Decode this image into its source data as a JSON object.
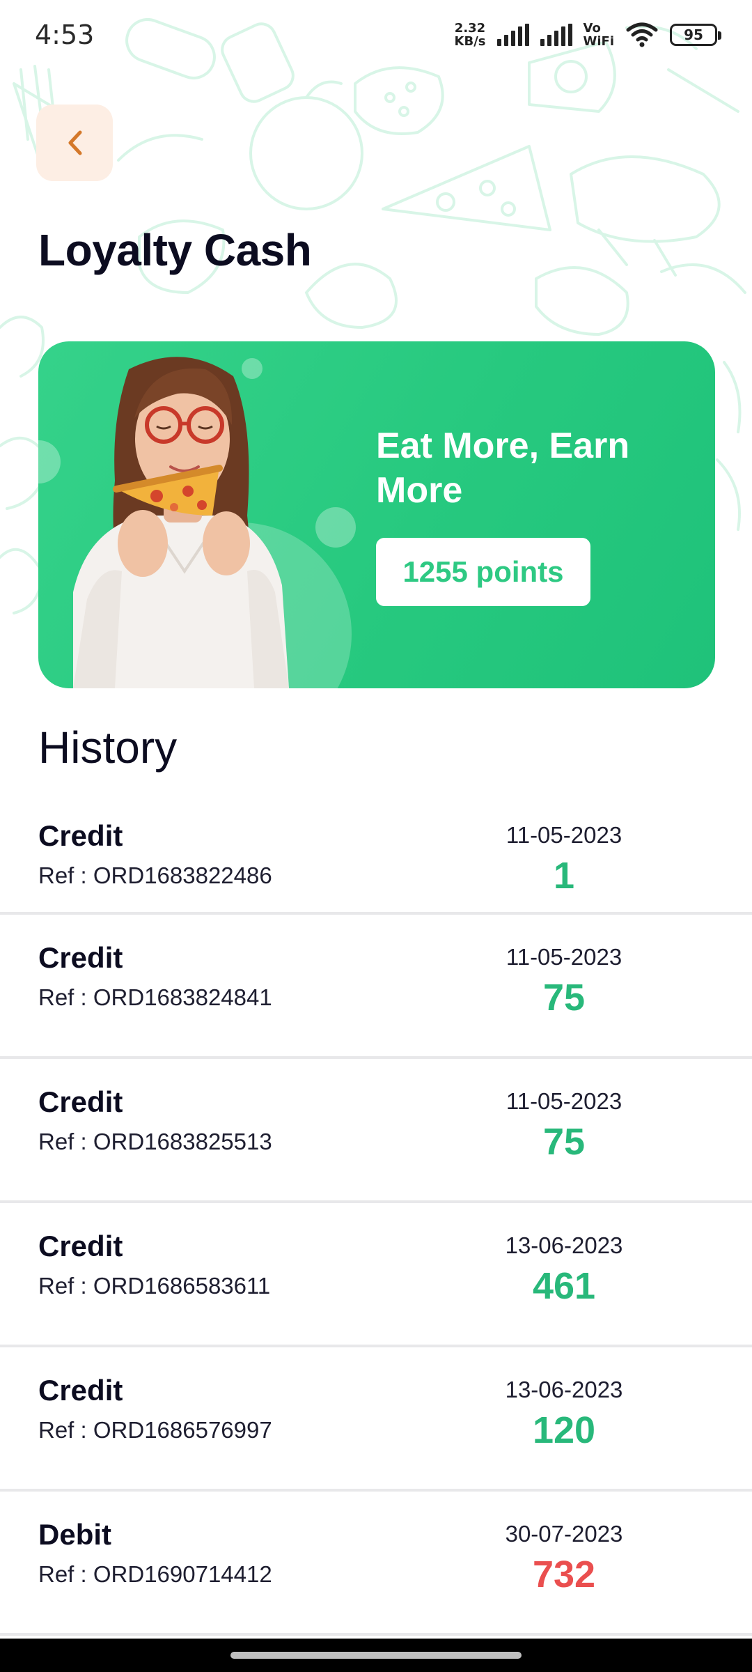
{
  "status_bar": {
    "time": "4:53",
    "net_speed_value": "2.32",
    "net_speed_unit": "KB/s",
    "vowifi_top": "Vo",
    "vowifi_bottom": "WiFi",
    "battery": "95"
  },
  "header": {
    "back_icon": "chevron-left-icon",
    "title": "Loyalty Cash"
  },
  "banner": {
    "headline": "Eat More, Earn More",
    "points": "1255 points",
    "image": "woman-eating-pizza"
  },
  "history": {
    "title": "History",
    "items": [
      {
        "type": "Credit",
        "ref": "Ref : ORD1683822486",
        "date": "11-05-2023",
        "amount": "1"
      },
      {
        "type": "Credit",
        "ref": "Ref : ORD1683824841",
        "date": "11-05-2023",
        "amount": "75"
      },
      {
        "type": "Credit",
        "ref": "Ref : ORD1683825513",
        "date": "11-05-2023",
        "amount": "75"
      },
      {
        "type": "Credit",
        "ref": "Ref : ORD1686583611",
        "date": "13-06-2023",
        "amount": "461"
      },
      {
        "type": "Credit",
        "ref": "Ref : ORD1686576997",
        "date": "13-06-2023",
        "amount": "120"
      },
      {
        "type": "Debit",
        "ref": "Ref : ORD1690714412",
        "date": "30-07-2023",
        "amount": "732"
      }
    ]
  },
  "colors": {
    "accent_green": "#2ec983",
    "credit": "#28b87a",
    "debit": "#ea4f4f",
    "back_button_bg": "#fdeee4",
    "back_icon": "#d4782a"
  }
}
